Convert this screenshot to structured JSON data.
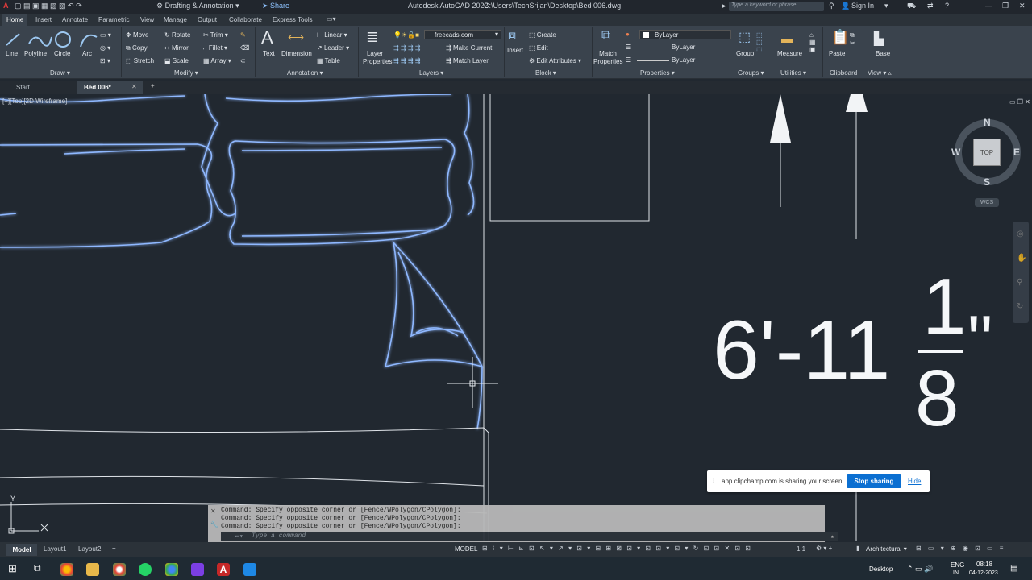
{
  "app": {
    "title": "Autodesk AutoCAD 2022",
    "file_path": "C:\\Users\\TechSrijan\\Desktop\\Bed 006.dwg",
    "workspace": "Drafting & Annotation",
    "share": "Share",
    "search_placeholder": "Type a keyword or phrase",
    "sign_in": "Sign In"
  },
  "ribbon_tabs": [
    "Home",
    "Insert",
    "Annotate",
    "Parametric",
    "View",
    "Manage",
    "Output",
    "Collaborate",
    "Express Tools"
  ],
  "ribbon": {
    "draw": {
      "line": "Line",
      "polyline": "Polyline",
      "circle": "Circle",
      "arc": "Arc",
      "label": "Draw"
    },
    "modify": {
      "move": "Move",
      "rotate": "Rotate",
      "trim": "Trim",
      "copy": "Copy",
      "mirror": "Mirror",
      "fillet": "Fillet",
      "stretch": "Stretch",
      "scale": "Scale",
      "array": "Array",
      "label": "Modify"
    },
    "annotation": {
      "text": "Text",
      "dimension": "Dimension",
      "linear": "Linear",
      "leader": "Leader",
      "table": "Table",
      "label": "Annotation"
    },
    "layers": {
      "layer_properties": "Layer Properties",
      "layer_name": "freecads.com",
      "make_current": "Make Current",
      "match_layer": "Match Layer",
      "label": "Layers"
    },
    "block": {
      "insert": "Insert",
      "create": "Create",
      "edit": "Edit",
      "edit_attributes": "Edit Attributes",
      "label": "Block"
    },
    "properties": {
      "match": "Match Properties",
      "color": "ByLayer",
      "linetype": "ByLayer",
      "lineweight": "ByLayer",
      "label": "Properties"
    },
    "groups": {
      "group": "Group",
      "label": "Groups"
    },
    "utilities": {
      "measure": "Measure",
      "label": "Utilities"
    },
    "clipboard": {
      "paste": "Paste",
      "label": "Clipboard"
    },
    "view": {
      "base": "Base",
      "label": "View"
    }
  },
  "file_tabs": {
    "start": "Start",
    "doc": "Bed 006*"
  },
  "viewport": {
    "label": "[−][Top][2D Wireframe]",
    "dimension_main": "6'-11",
    "frac_num": "1",
    "frac_den": "8",
    "inch": "\"",
    "viewcube": {
      "n": "N",
      "s": "S",
      "e": "E",
      "w": "W",
      "top": "TOP",
      "wcs": "WCS"
    },
    "ucs_y": "Y"
  },
  "command": {
    "history": [
      "Command: Specify opposite corner or [Fence/WPolygon/CPolygon]:",
      "Command: Specify opposite corner or [Fence/WPolygon/CPolygon]:",
      "Command: Specify opposite corner or [Fence/WPolygon/CPolygon]:"
    ],
    "placeholder": "Type a command"
  },
  "share_bar": {
    "message": "app.clipchamp.com is sharing your screen.",
    "stop": "Stop sharing",
    "hide": "Hide"
  },
  "layout_tabs": [
    "Model",
    "Layout1",
    "Layout2"
  ],
  "status": {
    "model": "MODEL",
    "units": "Architectural",
    "scale": "1:1"
  },
  "taskbar": {
    "desktop": "Desktop",
    "lang": "ENG",
    "region": "IN",
    "time": "08:18",
    "date": "04-12-2023"
  }
}
